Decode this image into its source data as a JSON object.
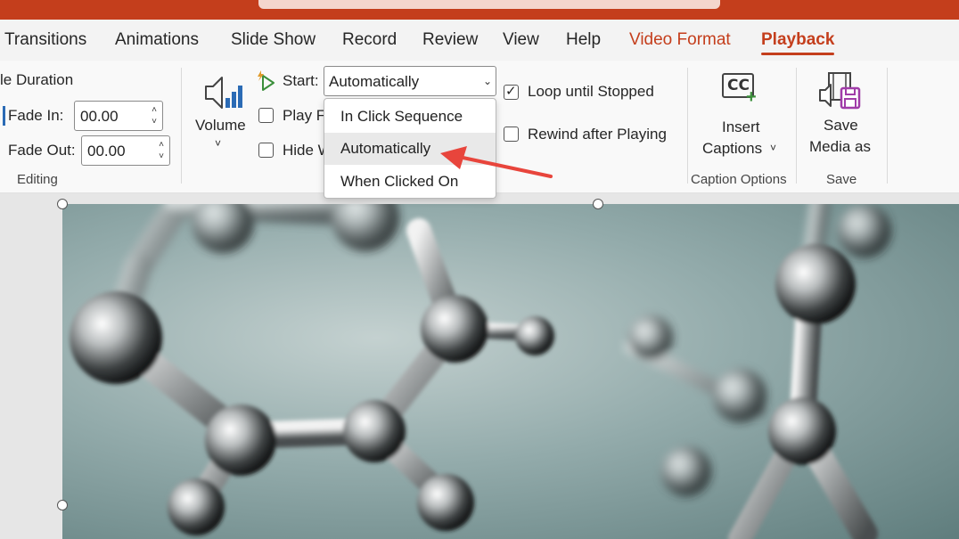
{
  "tabs": [
    {
      "label": "Transitions",
      "state": "normal"
    },
    {
      "label": "Animations",
      "state": "normal"
    },
    {
      "label": "Slide Show",
      "state": "normal"
    },
    {
      "label": "Record",
      "state": "normal"
    },
    {
      "label": "Review",
      "state": "normal"
    },
    {
      "label": "View",
      "state": "normal"
    },
    {
      "label": "Help",
      "state": "normal"
    },
    {
      "label": "Video Format",
      "state": "contextual"
    },
    {
      "label": "Playback",
      "state": "active"
    }
  ],
  "editing": {
    "fade_duration_label": "le Duration",
    "fade_in_label": "Fade In:",
    "fade_in_value": "00.00",
    "fade_out_label": "Fade Out:",
    "fade_out_value": "00.00",
    "group_label": "Editing"
  },
  "video_options": {
    "volume_label": "Volume",
    "start_label": "Start:",
    "start_value": "Automatically",
    "play_fullscreen_label": "Play F",
    "hide_label": "Hide W",
    "loop_label": "Loop until Stopped",
    "loop_checked": true,
    "rewind_label": "Rewind after Playing",
    "rewind_checked": false,
    "start_options": [
      "In Click Sequence",
      "Automatically",
      "When Clicked On"
    ],
    "highlighted_option": "Automatically"
  },
  "captions": {
    "insert_line1": "Insert",
    "insert_line2": "Captions",
    "cc_text": "CC",
    "group_label": "Caption Options"
  },
  "save": {
    "line1": "Save",
    "line2": "Media as",
    "group_label": "Save"
  },
  "colors": {
    "accent": "#c43e1c",
    "arrow": "#e8453c"
  }
}
